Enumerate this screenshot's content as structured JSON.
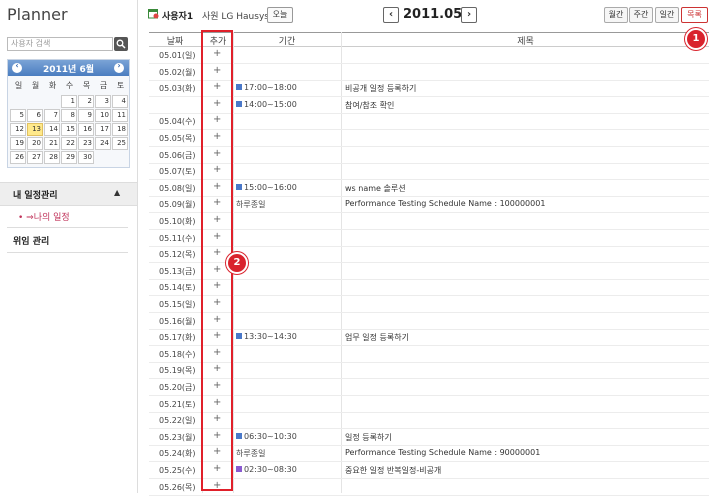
{
  "app": {
    "title": "Planner"
  },
  "search": {
    "placeholder": "사용자 검색"
  },
  "calendar": {
    "title": "2011년 6월",
    "weekdays": [
      "일",
      "월",
      "화",
      "수",
      "목",
      "금",
      "토"
    ],
    "today": "13",
    "weeks": [
      [
        "",
        "",
        "",
        "1",
        "2",
        "3",
        "4"
      ],
      [
        "5",
        "6",
        "7",
        "8",
        "9",
        "10",
        "11"
      ],
      [
        "12",
        "13",
        "14",
        "15",
        "16",
        "17",
        "18"
      ],
      [
        "19",
        "20",
        "21",
        "22",
        "23",
        "24",
        "25"
      ],
      [
        "26",
        "27",
        "28",
        "29",
        "30",
        "",
        ""
      ]
    ]
  },
  "sidebar": {
    "menu1": "내 일정관리",
    "menu1_caret": "▲",
    "sub1": "• ⇒나의 일정",
    "menu2": "위임 관리"
  },
  "topbar": {
    "user_name": "사용자1",
    "user_org": "사원 LG Hausys",
    "today_btn": "오늘",
    "prev": "‹",
    "next": "›",
    "month": "2011.05",
    "views": [
      "월간",
      "주간",
      "일간",
      "목록"
    ],
    "active_view": "목록"
  },
  "table": {
    "headers": {
      "date": "날짜",
      "add": "추가",
      "period": "기간",
      "subject": "제목"
    },
    "rows": [
      {
        "date": "05.01(일)",
        "plus": "+",
        "time": "",
        "subject": "",
        "color": ""
      },
      {
        "date": "05.02(월)",
        "plus": "+",
        "time": "",
        "subject": "",
        "color": ""
      },
      {
        "date": "05.03(화)",
        "plus": "+",
        "time": "17:00~18:00",
        "subject": "비공개 일정 등록하기",
        "color": "#4a78c8"
      },
      {
        "date": "",
        "plus": "+",
        "time": "14:00~15:00",
        "subject": "참여/참조 확인",
        "color": "#4a78c8"
      },
      {
        "date": "05.04(수)",
        "plus": "+",
        "time": "",
        "subject": "",
        "color": ""
      },
      {
        "date": "05.05(목)",
        "plus": "+",
        "time": "",
        "subject": "",
        "color": ""
      },
      {
        "date": "05.06(금)",
        "plus": "+",
        "time": "",
        "subject": "",
        "color": ""
      },
      {
        "date": "05.07(토)",
        "plus": "+",
        "time": "",
        "subject": "",
        "color": ""
      },
      {
        "date": "05.08(일)",
        "plus": "+",
        "time": "15:00~16:00",
        "subject": "ws name 솔루션",
        "color": "#4a78c8"
      },
      {
        "date": "05.09(월)",
        "plus": "+",
        "time": "하루종일",
        "subject": "Performance Testing Schedule Name : 100000001",
        "color": ""
      },
      {
        "date": "05.10(화)",
        "plus": "+",
        "time": "",
        "subject": "",
        "color": ""
      },
      {
        "date": "05.11(수)",
        "plus": "+",
        "time": "",
        "subject": "",
        "color": ""
      },
      {
        "date": "05.12(목)",
        "plus": "+",
        "time": "",
        "subject": "",
        "color": ""
      },
      {
        "date": "05.13(금)",
        "plus": "+",
        "time": "",
        "subject": "",
        "color": ""
      },
      {
        "date": "05.14(토)",
        "plus": "+",
        "time": "",
        "subject": "",
        "color": ""
      },
      {
        "date": "05.15(일)",
        "plus": "+",
        "time": "",
        "subject": "",
        "color": ""
      },
      {
        "date": "05.16(월)",
        "plus": "+",
        "time": "",
        "subject": "",
        "color": ""
      },
      {
        "date": "05.17(화)",
        "plus": "+",
        "time": "13:30~14:30",
        "subject": "업무 일정 등록하기",
        "color": "#4a78c8"
      },
      {
        "date": "05.18(수)",
        "plus": "+",
        "time": "",
        "subject": "",
        "color": ""
      },
      {
        "date": "05.19(목)",
        "plus": "+",
        "time": "",
        "subject": "",
        "color": ""
      },
      {
        "date": "05.20(금)",
        "plus": "+",
        "time": "",
        "subject": "",
        "color": ""
      },
      {
        "date": "05.21(토)",
        "plus": "+",
        "time": "",
        "subject": "",
        "color": ""
      },
      {
        "date": "05.22(일)",
        "plus": "+",
        "time": "",
        "subject": "",
        "color": ""
      },
      {
        "date": "05.23(월)",
        "plus": "+",
        "time": "06:30~10:30",
        "subject": "일정 등록하기",
        "color": "#4a78c8"
      },
      {
        "date": "05.24(화)",
        "plus": "+",
        "time": "하루종일",
        "subject": "Performance Testing Schedule Name : 90000001",
        "color": ""
      },
      {
        "date": "05.25(수)",
        "plus": "+",
        "time": "02:30~08:30",
        "subject": "중요한 일정 반복일정-비공개",
        "color": "#8a5ad0"
      },
      {
        "date": "05.26(목)",
        "plus": "+",
        "time": "",
        "subject": "",
        "color": ""
      }
    ]
  },
  "badges": {
    "one": "1",
    "two": "2"
  },
  "colors": {
    "highlight": "#e0202a",
    "badge": "#d9232d",
    "accent_sub": "#c0335a"
  }
}
